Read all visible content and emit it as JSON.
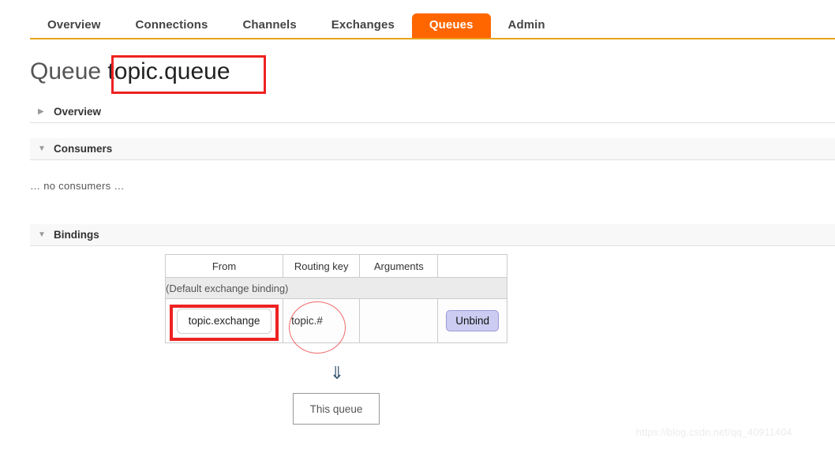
{
  "nav": {
    "items": [
      {
        "label": "Overview",
        "active": false
      },
      {
        "label": "Connections",
        "active": false
      },
      {
        "label": "Channels",
        "active": false
      },
      {
        "label": "Exchanges",
        "active": false
      },
      {
        "label": "Queues",
        "active": true
      },
      {
        "label": "Admin",
        "active": false
      }
    ],
    "accent_color": "#ff6600",
    "rule_color": "#e8a317"
  },
  "title": {
    "prefix": "Queue",
    "queue_name": "topic.queue"
  },
  "sections": {
    "overview": {
      "label": "Overview",
      "expanded": false,
      "triangle": "collapsed-triangle-icon"
    },
    "consumers": {
      "label": "Consumers",
      "expanded": true,
      "triangle": "expanded-triangle-icon"
    },
    "bindings": {
      "label": "Bindings",
      "expanded": true,
      "triangle": "expanded-triangle-icon"
    }
  },
  "consumers": {
    "empty_text": "… no consumers …"
  },
  "bindings": {
    "columns": [
      "From",
      "Routing key",
      "Arguments",
      ""
    ],
    "default_binding_text": "(Default exchange binding)",
    "rows": [
      {
        "from": "topic.exchange",
        "routing_key": "topic.#",
        "arguments": "",
        "action_label": "Unbind"
      }
    ]
  },
  "flow": {
    "arrow": "double-down-arrow-icon",
    "arrow_glyph": "⇓",
    "target_label": "This queue"
  },
  "annotations": {
    "title_box_color": "#ee2222",
    "exchange_box_color": "#ee2222",
    "routing_key_circle_color": "#f06a6a"
  },
  "watermark": {
    "text": "https://blog.csdn.net/qq_40911404"
  }
}
